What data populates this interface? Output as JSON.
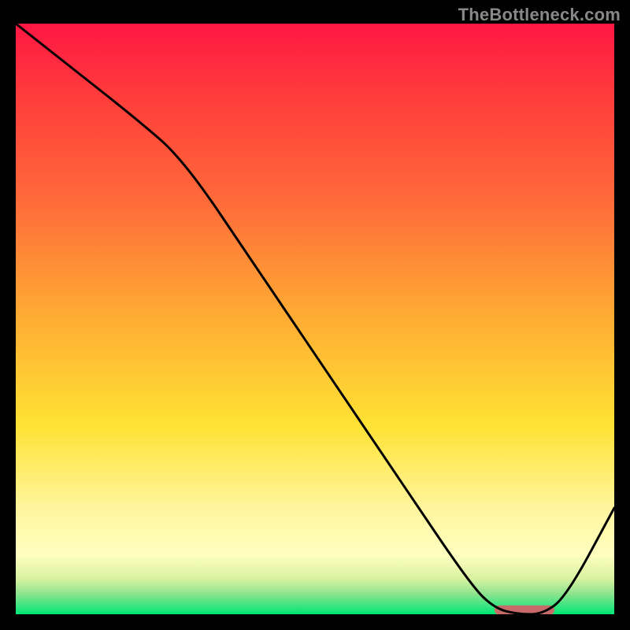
{
  "watermark": "TheBottleneck.com",
  "chart_data": {
    "type": "line",
    "title": "",
    "xlabel": "",
    "ylabel": "",
    "xlim": [
      0,
      100
    ],
    "ylim": [
      0,
      100
    ],
    "grid": false,
    "legend": false,
    "series": [
      {
        "name": "bottleneck-curve",
        "x": [
          0,
          10,
          20,
          28,
          40,
          52,
          64,
          76,
          80,
          84,
          88,
          92,
          100
        ],
        "y": [
          100,
          92,
          84,
          77,
          59,
          41,
          23,
          5,
          1,
          0,
          0,
          3,
          18
        ]
      }
    ],
    "marker": {
      "name": "optimal-zone",
      "x_start": 80,
      "x_end": 90,
      "y": 0.7,
      "color": "#c96a6a"
    },
    "gradient_stops": [
      {
        "offset": 0.0,
        "color": "#ff1744"
      },
      {
        "offset": 0.12,
        "color": "#ff3b3b"
      },
      {
        "offset": 0.3,
        "color": "#ff6a3a"
      },
      {
        "offset": 0.5,
        "color": "#ffad33"
      },
      {
        "offset": 0.68,
        "color": "#ffe233"
      },
      {
        "offset": 0.82,
        "color": "#fff59d"
      },
      {
        "offset": 0.9,
        "color": "#ffffc0"
      },
      {
        "offset": 0.94,
        "color": "#d8f2a0"
      },
      {
        "offset": 0.965,
        "color": "#8fe38f"
      },
      {
        "offset": 1.0,
        "color": "#00e676"
      }
    ]
  }
}
